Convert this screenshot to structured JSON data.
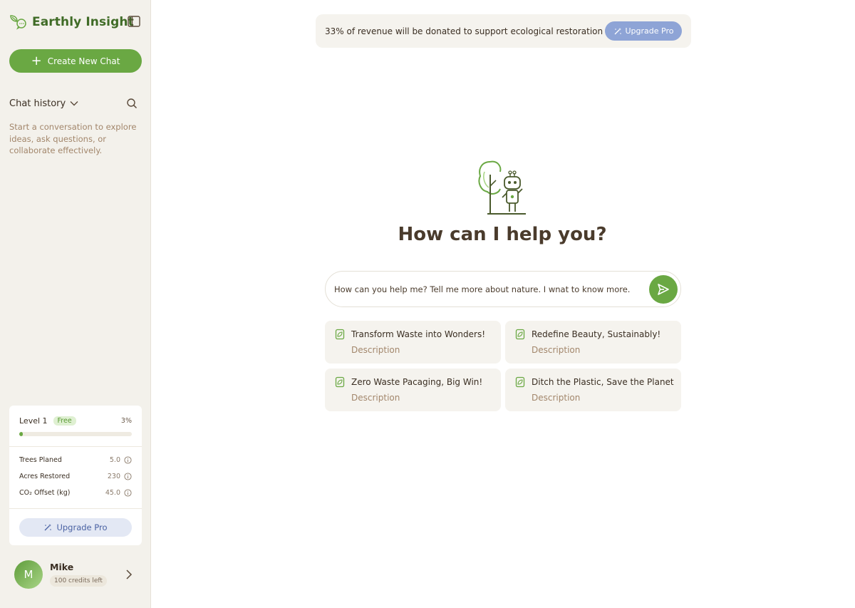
{
  "app": {
    "name": "Earthly Insight",
    "colors": {
      "brand": "#6aa843",
      "brand_dark": "#3f6b26",
      "accent_blue": "#8ea4d6",
      "sidebar_bg": "#f3f1eb",
      "muted_text": "#a2866b"
    }
  },
  "sidebar": {
    "create_chat_label": "Create New Chat",
    "history_label": "Chat history",
    "history_hint": "Start a conversation to explore ideas, ask questions, or collaborate effectively.",
    "icons": [
      "leaf-chat-logo-icon",
      "sidebar-toggle-icon",
      "plus-icon",
      "chevron-down-icon",
      "search-icon"
    ]
  },
  "level_card": {
    "level_label": "Level 1",
    "tier_badge": "Free",
    "progress_text": "3%",
    "progress_fraction": 0.03,
    "stats": [
      {
        "label": "Trees Planed",
        "value": "5.0"
      },
      {
        "label": "Acres Restored",
        "value": "230"
      },
      {
        "label": "CO₂ Offset (kg)",
        "value": "45.0"
      }
    ],
    "upgrade_label": "Upgrade Pro"
  },
  "user": {
    "initial": "M",
    "name": "Mike",
    "credits": "100 credits left"
  },
  "banner": {
    "text": "33% of revenue will be donated to support ecological restoration",
    "button_label": "Upgrade Pro"
  },
  "main": {
    "title": "How can I help you?",
    "prompt_value": "How can you help me? Tell me more about nature. I wnat to know more.",
    "suggestions": [
      {
        "title": "Transform Waste into Wonders!",
        "description": "Description"
      },
      {
        "title": "Redefine Beauty, Sustainably!",
        "description": "Description"
      },
      {
        "title": "Zero Waste Pacaging, Big Win!",
        "description": "Description"
      },
      {
        "title": "Ditch the Plastic, Save the Planet",
        "description": "Description"
      }
    ]
  }
}
